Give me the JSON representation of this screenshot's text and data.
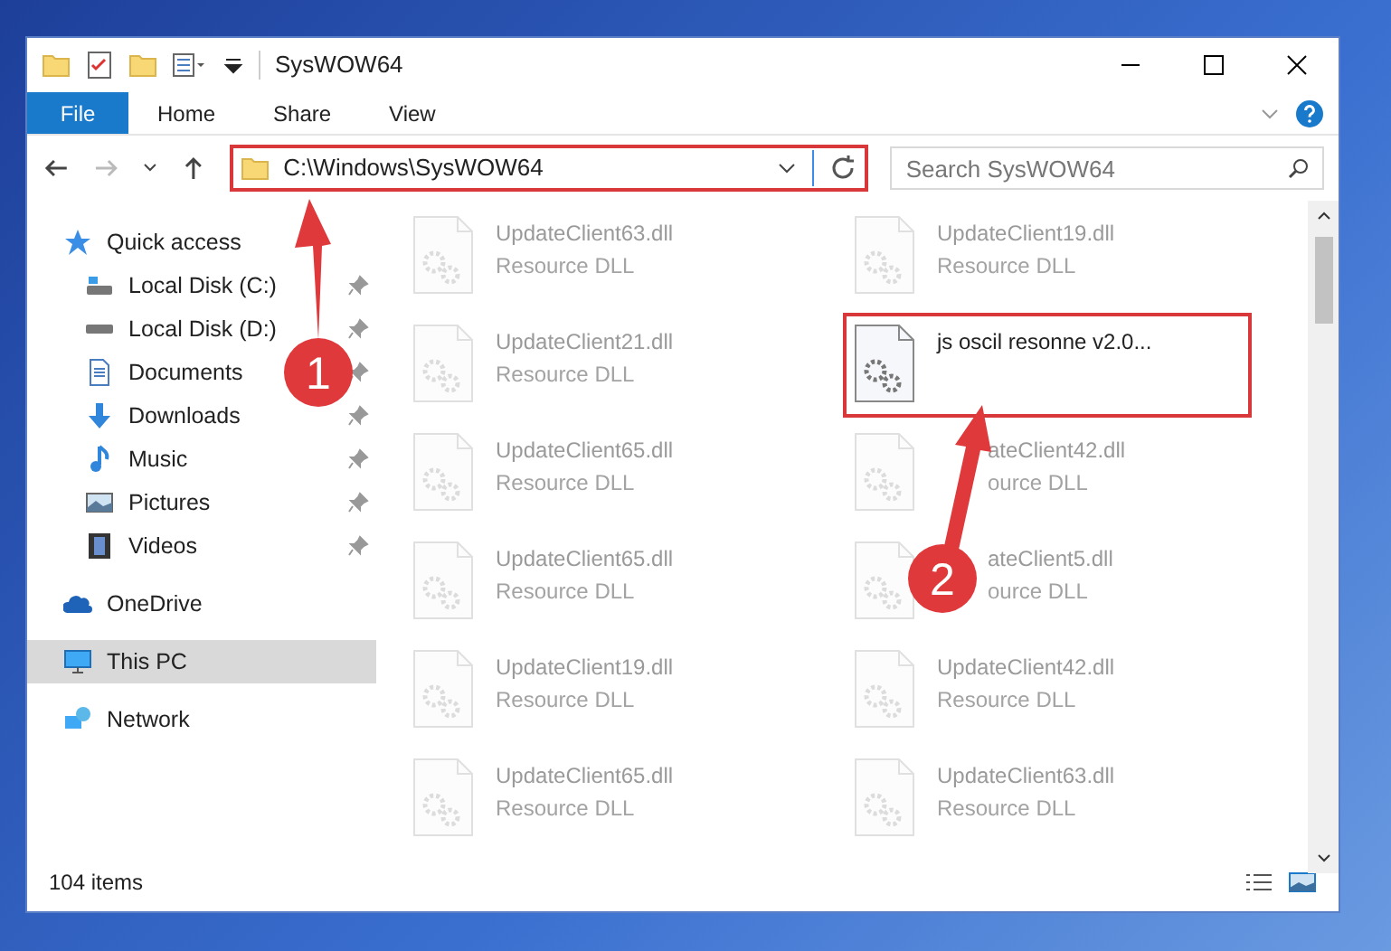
{
  "window": {
    "title": "SysWOW64"
  },
  "ribbon": {
    "file_button": "File",
    "tabs": [
      {
        "label": "Home"
      },
      {
        "label": "Share"
      },
      {
        "label": "View"
      }
    ]
  },
  "address": {
    "path": "C:\\Windows\\SysWOW64",
    "highlighted": true
  },
  "search": {
    "placeholder": "Search SysWOW64"
  },
  "sidebar": {
    "items": [
      {
        "label": "Quick access",
        "selected": false,
        "children": [
          {
            "label": "Local Disk (C:)",
            "pinned": true,
            "selected": false
          },
          {
            "label": "Local Disk (D:)",
            "pinned": true,
            "selected": false
          },
          {
            "label": "Documents",
            "pinned": true,
            "selected": false
          },
          {
            "label": "Downloads",
            "pinned": true,
            "selected": false
          },
          {
            "label": "Music",
            "pinned": true,
            "selected": false
          },
          {
            "label": "Pictures",
            "pinned": true,
            "selected": false
          },
          {
            "label": "Videos",
            "pinned": true,
            "selected": false
          }
        ]
      },
      {
        "label": "OneDrive",
        "selected": false
      },
      {
        "label": "This PC",
        "selected": true
      },
      {
        "label": "Network",
        "selected": false
      }
    ]
  },
  "files": [
    {
      "name": "UpdateClient63.dll",
      "type": "Resource DLL",
      "dimmed": true,
      "highlighted": false
    },
    {
      "name": "UpdateClient19.dll",
      "type": "Resource DLL",
      "dimmed": true,
      "highlighted": false
    },
    {
      "name": "UpdateClient21.dll",
      "type": "Resource DLL",
      "dimmed": true,
      "highlighted": false
    },
    {
      "name": "js oscil resonne v2.0...",
      "dimmed": false,
      "highlighted": true
    },
    {
      "name": "UpdateClient65.dll",
      "type": "Resource DLL",
      "dimmed": true,
      "highlighted": false
    },
    {
      "name": "ateClient42.dll",
      "type": "ource DLL",
      "dimmed": true,
      "highlighted": false,
      "partly_covered": true
    },
    {
      "name": "UpdateClient65.dll",
      "type": "Resource DLL",
      "dimmed": true,
      "highlighted": false
    },
    {
      "name": "ateClient5.dll",
      "type": "ource DLL",
      "dimmed": true,
      "highlighted": false,
      "partly_covered": true
    },
    {
      "name": "UpdateClient19.dll",
      "type": "Resource DLL",
      "dimmed": true,
      "highlighted": false
    },
    {
      "name": "UpdateClient42.dll",
      "type": "Resource DLL",
      "dimmed": true,
      "highlighted": false
    },
    {
      "name": "UpdateClient65.dll",
      "type": "Resource DLL",
      "dimmed": true,
      "highlighted": false
    },
    {
      "name": "UpdateClient63.dll",
      "type": "Resource DLL",
      "dimmed": true,
      "highlighted": false
    }
  ],
  "annotations": [
    {
      "label": "1"
    },
    {
      "label": "2"
    }
  ],
  "status_bar": {
    "item_count": "104 items"
  }
}
